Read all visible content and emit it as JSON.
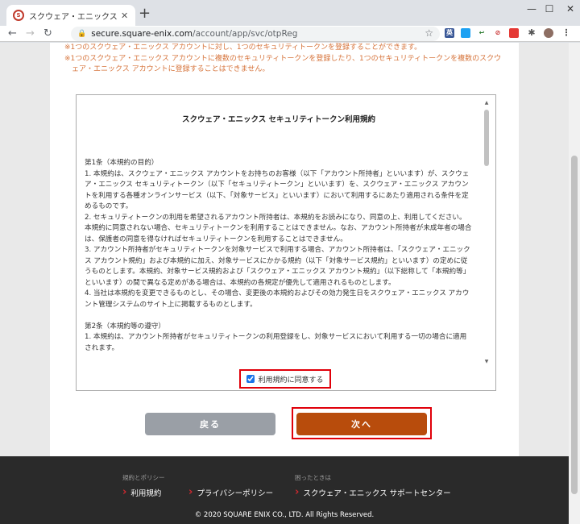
{
  "browser": {
    "tab_title": "スクウェア・エニックス アカウント管理：",
    "tab_favicon": "S",
    "new_tab": "+",
    "minimize": "—",
    "maximize": "☐",
    "close": "✕",
    "url_host": "secure.square-enix.com",
    "url_path": "/account/app/svc/otpReg",
    "extension_badge": "英"
  },
  "notes": [
    "※1つのスクウェア・エニックス アカウントに対し、1つのセキュリティトークンを登録することができます。",
    "※1つのスクウェア・エニックス アカウントに複数のセキュリティトークンを登録したり、1つのセキュリティトークンを複数のスクウェア・エニックス アカウントに登録することはできません。"
  ],
  "terms": {
    "title": "スクウェア・エニックス セキュリティトークン利用規約",
    "sections": [
      {
        "heading": "第1条（本規約の目的）",
        "paragraphs": [
          "1. 本規約は、スクウェア・エニックス アカウントをお持ちのお客様（以下「アカウント所持者」といいます）が、スクウェア・エニックス セキュリティトークン（以下「セキュリティトークン」といいます）を、スクウェア・エニックス アカウントを利用する各種オンラインサービス（以下、「対象サービス」といいます）において利用するにあたり適用される条件を定めるものです。",
          "2. セキュリティトークンの利用を希望されるアカウント所持者は、本規約をお読みになり、同意の上、利用してください。本規約に同意されない場合、セキュリティトークンを利用することはできません。なお、アカウント所持者が未成年者の場合は、保護者の同意を得なければセキュリティトークンを利用することはできません。",
          "3. アカウント所持者がセキュリティトークンを対象サービスで利用する場合、アカウント所持者は、「スクウェア・エニックス アカウント規約」および本規約に加え、対象サービスにかかる規約（以下「対象サービス規約」といいます）の定めに従うものとします。本規約、対象サービス規約および「スクウェア・エニックス アカウント規約」（以下総称して「本規約等」といいます）の間で異なる定めがある場合は、本規約の各規定が優先して適用されるものとします。",
          "4. 当社は本規約を変更できるものとし、その場合、変更後の本規約およびその効力発生日をスクウェア・エニックス アカウント管理システムのサイト上に掲載するものとします。"
        ]
      },
      {
        "heading": "第2条（本規約等の遵守）",
        "paragraphs": [
          "1. 本規約は、アカウント所持者がセキュリティトークンの利用登録をし、対象サービスにおいて利用する一切の場合に適用されます。"
        ]
      }
    ],
    "agree_label": "利用規約に同意する",
    "agree_checked": true
  },
  "buttons": {
    "back": "戻る",
    "next": "次へ"
  },
  "footer": {
    "policy_heading": "規約とポリシー",
    "help_heading": "困ったときは",
    "terms_link": "利用規約",
    "privacy_link": "プライバシーポリシー",
    "support_link": "スクウェア・エニックス サポートセンター",
    "copyright": "© 2020 SQUARE ENIX CO., LTD. All Rights Reserved."
  },
  "colors": {
    "accent_orange": "#d6733a",
    "next_button": "#b84c0c",
    "back_button": "#9a9fa6",
    "highlight_red": "#e0000a",
    "footer_bg": "#2a2a2a"
  }
}
